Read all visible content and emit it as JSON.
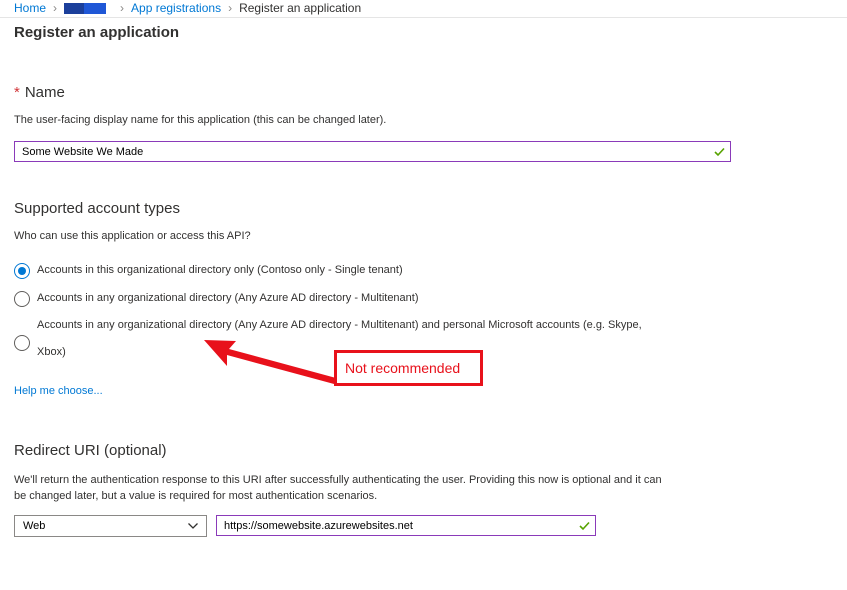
{
  "breadcrumb": {
    "home": "Home",
    "app_registrations": "App registrations",
    "current": "Register an application"
  },
  "page_title": "Register an application",
  "name_section": {
    "required_marker": "*",
    "title": "Name",
    "description": "The user-facing display name for this application (this can be changed later).",
    "value": "Some Website We Made"
  },
  "account_types": {
    "title": "Supported account types",
    "question": "Who can use this application or access this API?",
    "options": [
      {
        "label": "Accounts in this organizational directory only (Contoso only - Single tenant)",
        "selected": true
      },
      {
        "label": "Accounts in any organizational directory (Any Azure AD directory - Multitenant)",
        "selected": false
      },
      {
        "label_line1": "Accounts in any organizational directory (Any Azure AD directory - Multitenant) and personal Microsoft accounts (e.g. Skype,",
        "label_line2": "Xbox)",
        "selected": false
      }
    ],
    "help_link": "Help me choose..."
  },
  "annotation": {
    "text": "Not recommended",
    "color": "#e8111b"
  },
  "redirect": {
    "title": "Redirect URI (optional)",
    "description_line1": "We'll return the authentication response to this URI after successfully authenticating the user. Providing this now is optional and it can",
    "description_line2": "be changed later, but a value is required for most authentication scenarios.",
    "platform_value": "Web",
    "uri_value": "https://somewebsite.azurewebsites.net"
  },
  "icons": {
    "valid": "checkmark-icon",
    "dropdown": "chevron-down-icon",
    "separator": "chevron-right-icon"
  },
  "colors": {
    "accent": "#0078d4",
    "required": "#d13438",
    "valid": "#57a300",
    "input_border": "#8a3ab9"
  }
}
